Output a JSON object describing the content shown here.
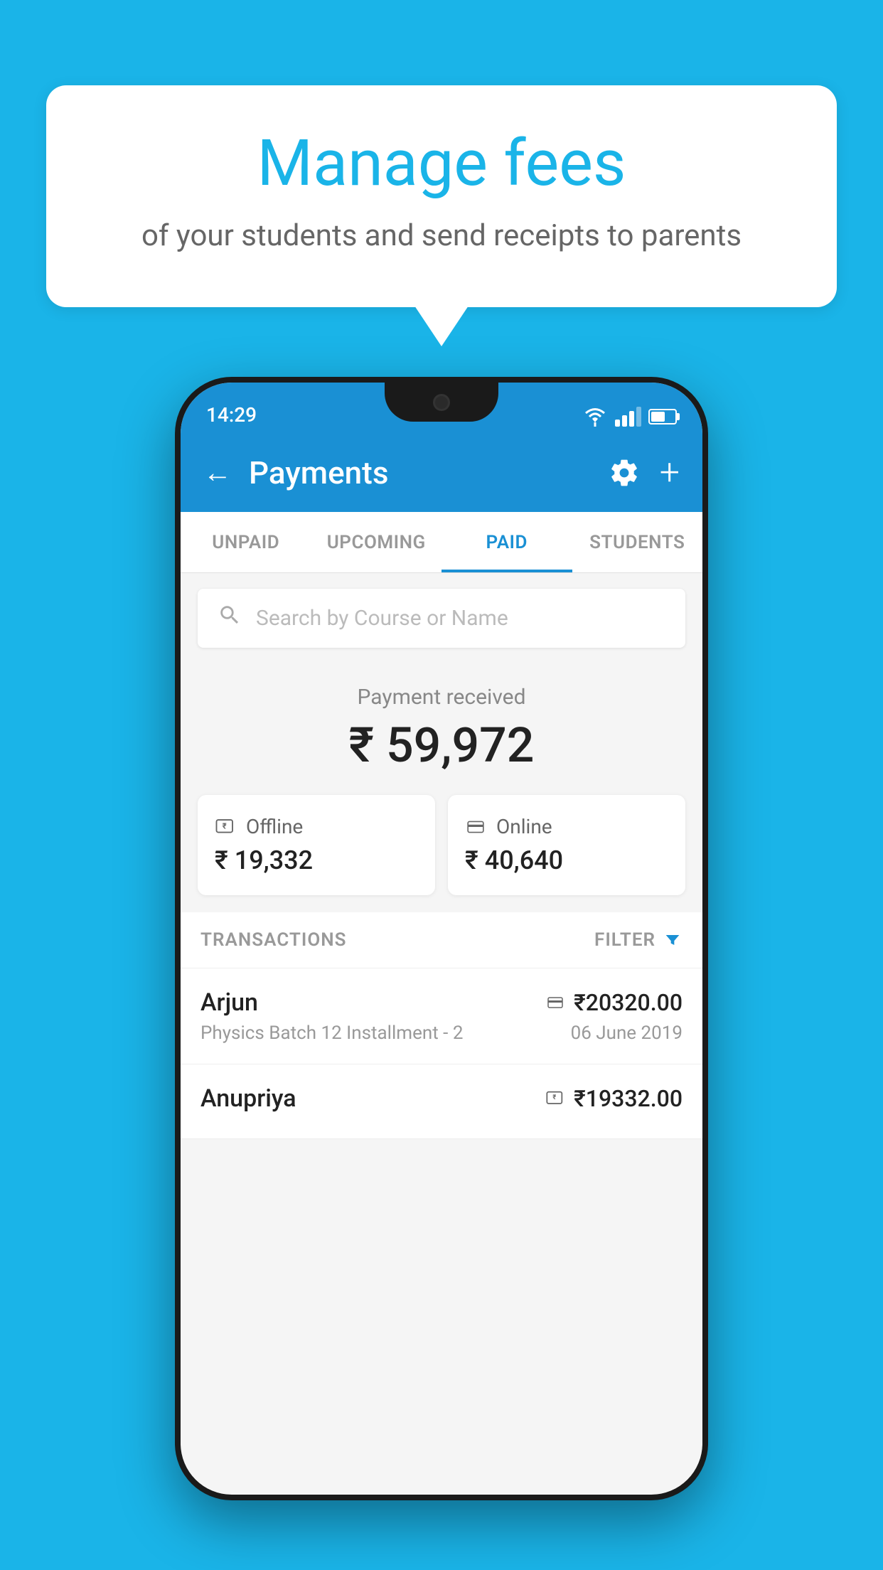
{
  "background_color": "#1ab4e8",
  "speech_bubble": {
    "title": "Manage fees",
    "subtitle": "of your students and send receipts to parents"
  },
  "phone": {
    "status_bar": {
      "time": "14:29"
    },
    "header": {
      "title": "Payments",
      "back_label": "←",
      "plus_label": "+"
    },
    "tabs": [
      {
        "label": "UNPAID",
        "active": false
      },
      {
        "label": "UPCOMING",
        "active": false
      },
      {
        "label": "PAID",
        "active": true
      },
      {
        "label": "STUDENTS",
        "active": false
      }
    ],
    "search": {
      "placeholder": "Search by Course or Name"
    },
    "payment_received": {
      "label": "Payment received",
      "amount": "₹ 59,972"
    },
    "payment_cards": [
      {
        "type": "Offline",
        "amount": "₹ 19,332",
        "icon": "rupee-box"
      },
      {
        "type": "Online",
        "amount": "₹ 40,640",
        "icon": "card"
      }
    ],
    "transactions_header": {
      "label": "TRANSACTIONS",
      "filter_label": "FILTER"
    },
    "transactions": [
      {
        "name": "Arjun",
        "amount": "₹20320.00",
        "payment_type": "card",
        "course": "Physics Batch 12 Installment - 2",
        "date": "06 June 2019"
      },
      {
        "name": "Anupriya",
        "amount": "₹19332.00",
        "payment_type": "rupee-box",
        "course": "",
        "date": ""
      }
    ]
  }
}
